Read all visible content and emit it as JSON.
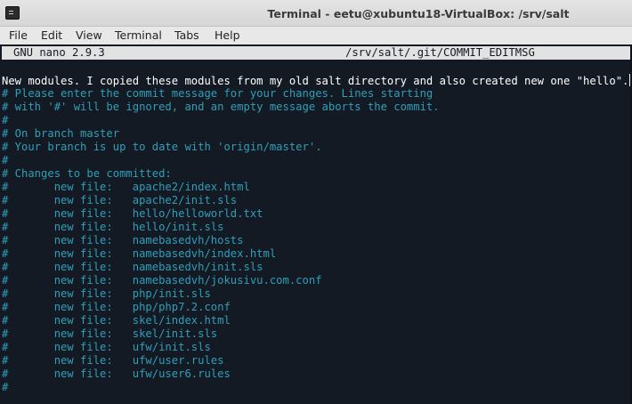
{
  "window": {
    "title": "Terminal - eetu@xubuntu18-VirtualBox: /srv/salt"
  },
  "menu": {
    "items": [
      "File",
      "Edit",
      "View",
      "Terminal",
      "Tabs",
      "Help"
    ]
  },
  "nano": {
    "version": "GNU nano 2.9.3",
    "filename": "/srv/salt/.git/COMMIT_EDITMSG"
  },
  "editor": {
    "commit_message": "New modules. I copied these modules from my old salt directory and also created new one \"hello\".",
    "lines": [
      "# Please enter the commit message for your changes. Lines starting",
      "# with '#' will be ignored, and an empty message aborts the commit.",
      "#",
      "# On branch master",
      "# Your branch is up to date with 'origin/master'.",
      "#",
      "# Changes to be committed:",
      "#       new file:   apache2/index.html",
      "#       new file:   apache2/init.sls",
      "#       new file:   hello/helloworld.txt",
      "#       new file:   hello/init.sls",
      "#       new file:   namebasedvh/hosts",
      "#       new file:   namebasedvh/index.html",
      "#       new file:   namebasedvh/init.sls",
      "#       new file:   namebasedvh/jokusivu.com.conf",
      "#       new file:   php/init.sls",
      "#       new file:   php/php7.2.conf",
      "#       new file:   skel/index.html",
      "#       new file:   skel/init.sls",
      "#       new file:   ufw/init.sls",
      "#       new file:   ufw/user.rules",
      "#       new file:   ufw/user6.rules",
      "#"
    ]
  },
  "colors": {
    "terminal_background": "#141a24",
    "message_text": "#ffffff",
    "comment_text": "#2f9fb8",
    "header_background": "#e2e2e2"
  }
}
